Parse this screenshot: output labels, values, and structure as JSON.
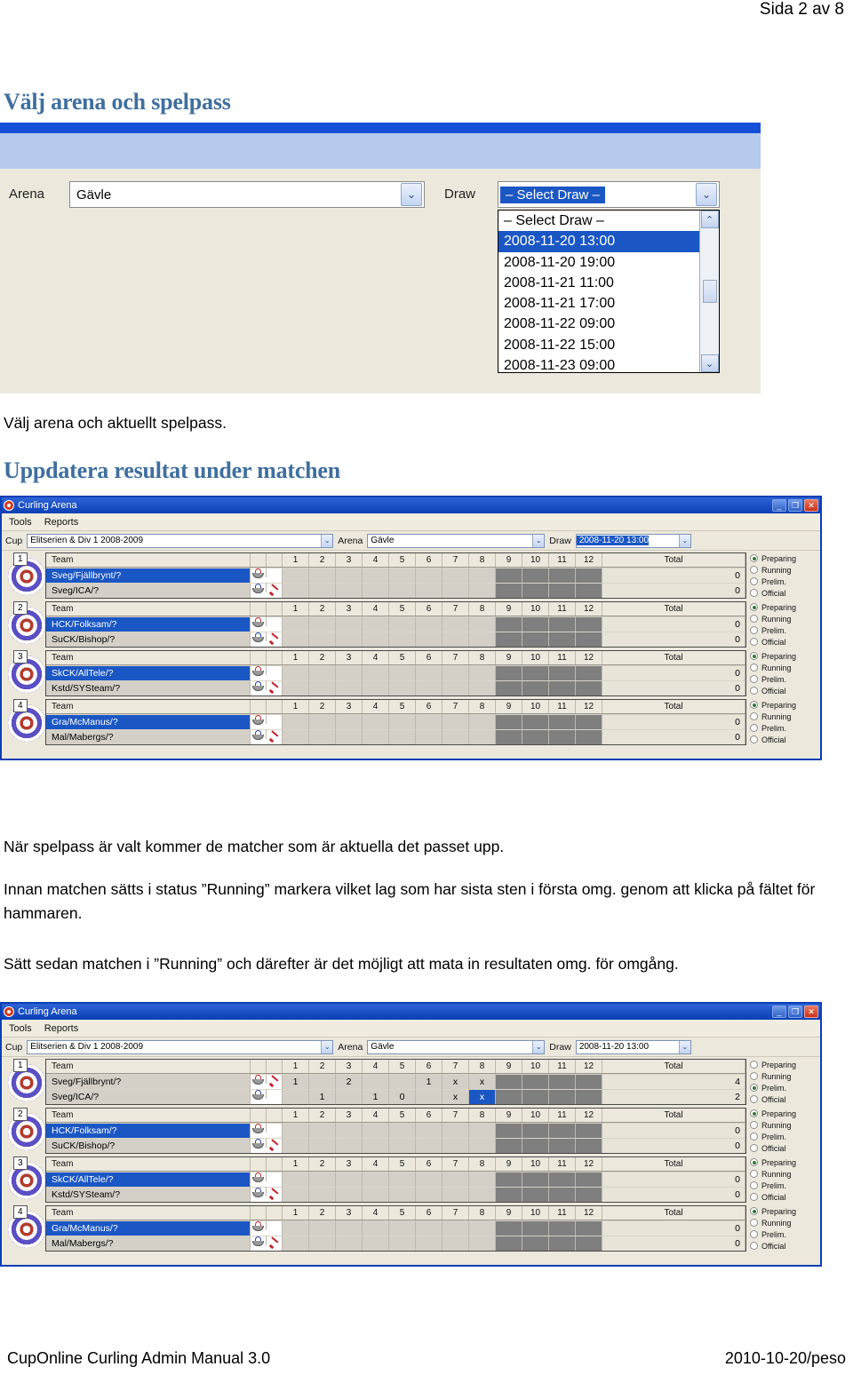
{
  "page": {
    "header_right": "Sida 2 av 8",
    "footer_left": "CupOnline Curling Admin Manual 3.0",
    "footer_right": "2010-10-20/peso"
  },
  "headings": {
    "h1": "Välj arena och spelpass",
    "h2": "Uppdatera resultat under matchen"
  },
  "paragraphs": {
    "p1": "Välj arena och aktuellt spelpass.",
    "p2": "När spelpass är valt kommer de matcher som är aktuella det passet upp.",
    "p3": "Innan matchen sätts i status ”Running” markera vilket lag som har sista sten i första omg. genom att klicka på fältet för hammaren.",
    "p4": "Sätt sedan matchen i ”Running” och därefter är det möjligt att mata in resultaten omg. för omgång."
  },
  "screenshot1": {
    "arena_label": "Arena",
    "arena_value": "Gävle",
    "draw_label": "Draw",
    "draw_value": "– Select Draw –",
    "draw_options": [
      "– Select Draw –",
      "2008-11-20 13:00",
      "2008-11-20 19:00",
      "2008-11-21 11:00",
      "2008-11-21 17:00",
      "2008-11-22 09:00",
      "2008-11-22 15:00",
      "2008-11-23 09:00"
    ],
    "draw_selected_index": 1,
    "dropdown_arrow": "⌄",
    "scroll_up": "⌃",
    "scroll_down": "⌄"
  },
  "window": {
    "title": "Curling Arena",
    "menu": [
      "Tools",
      "Reports"
    ],
    "btn_min": "_",
    "btn_max": "❐",
    "btn_close": "✕",
    "toolbar": {
      "cup_label": "Cup",
      "cup_value": "Elitserien & Div 1 2008-2009",
      "arena_label": "Arena",
      "arena_value": "Gävle",
      "draw_label": "Draw",
      "draw_value": "2008-11-20 13:00"
    },
    "columns": [
      "1",
      "2",
      "3",
      "4",
      "5",
      "6",
      "7",
      "8",
      "9",
      "10",
      "11",
      "12"
    ],
    "team_header": "Team",
    "total_header": "Total",
    "status_options": [
      "Preparing",
      "Running",
      "Prelim.",
      "Official"
    ]
  },
  "shot2": {
    "sheets": [
      {
        "number": "1",
        "status": "Preparing",
        "teams": [
          {
            "name": "Sveg/Fjällbrynt/?",
            "selected": true,
            "stone": "red",
            "hammer": false,
            "scores": [
              "",
              "",
              "",
              "",
              "",
              "",
              "",
              "",
              "",
              "",
              "",
              ""
            ],
            "total": "0"
          },
          {
            "name": "Sveg/ICA/?",
            "selected": false,
            "stone": "blue",
            "hammer": true,
            "scores": [
              "",
              "",
              "",
              "",
              "",
              "",
              "",
              "",
              "",
              "",
              "",
              ""
            ],
            "total": "0"
          }
        ]
      },
      {
        "number": "2",
        "status": "Preparing",
        "teams": [
          {
            "name": "HCK/Folksam/?",
            "selected": true,
            "stone": "red",
            "hammer": false,
            "scores": [
              "",
              "",
              "",
              "",
              "",
              "",
              "",
              "",
              "",
              "",
              "",
              ""
            ],
            "total": "0"
          },
          {
            "name": "SuCK/Bishop/?",
            "selected": false,
            "stone": "blue",
            "hammer": true,
            "scores": [
              "",
              "",
              "",
              "",
              "",
              "",
              "",
              "",
              "",
              "",
              "",
              ""
            ],
            "total": "0"
          }
        ]
      },
      {
        "number": "3",
        "status": "Preparing",
        "teams": [
          {
            "name": "SkCK/AllTele/?",
            "selected": true,
            "stone": "red",
            "hammer": false,
            "scores": [
              "",
              "",
              "",
              "",
              "",
              "",
              "",
              "",
              "",
              "",
              "",
              ""
            ],
            "total": "0"
          },
          {
            "name": "Kstd/SYSteam/?",
            "selected": false,
            "stone": "blue",
            "hammer": true,
            "scores": [
              "",
              "",
              "",
              "",
              "",
              "",
              "",
              "",
              "",
              "",
              "",
              ""
            ],
            "total": "0"
          }
        ]
      },
      {
        "number": "4",
        "status": "Preparing",
        "teams": [
          {
            "name": "Gra/McManus/?",
            "selected": true,
            "stone": "red",
            "hammer": false,
            "scores": [
              "",
              "",
              "",
              "",
              "",
              "",
              "",
              "",
              "",
              "",
              "",
              ""
            ],
            "total": "0"
          },
          {
            "name": "Mal/Mabergs/?",
            "selected": false,
            "stone": "blue",
            "hammer": true,
            "scores": [
              "",
              "",
              "",
              "",
              "",
              "",
              "",
              "",
              "",
              "",
              "",
              ""
            ],
            "total": "0"
          }
        ]
      }
    ]
  },
  "shot3": {
    "sheets": [
      {
        "number": "1",
        "status": "Prelim.",
        "teams": [
          {
            "name": "Sveg/Fjällbrynt/?",
            "selected": false,
            "stone": "red",
            "hammer": true,
            "scores": [
              "1",
              "",
              "2",
              "",
              "",
              "1",
              "x",
              "x",
              "",
              "",
              "",
              ""
            ],
            "total": "4",
            "selected_cell": -1
          },
          {
            "name": "Sveg/ICA/?",
            "selected": false,
            "stone": "blue",
            "hammer": false,
            "scores": [
              "",
              "1",
              "",
              "1",
              "0",
              "",
              "x",
              "x",
              "",
              "",
              "",
              ""
            ],
            "total": "2",
            "selected_cell": 7
          }
        ]
      },
      {
        "number": "2",
        "status": "Preparing",
        "teams": [
          {
            "name": "HCK/Folksam/?",
            "selected": true,
            "stone": "red",
            "hammer": false,
            "scores": [
              "",
              "",
              "",
              "",
              "",
              "",
              "",
              "",
              "",
              "",
              "",
              ""
            ],
            "total": "0",
            "selected_cell": -1
          },
          {
            "name": "SuCK/Bishop/?",
            "selected": false,
            "stone": "blue",
            "hammer": true,
            "scores": [
              "",
              "",
              "",
              "",
              "",
              "",
              "",
              "",
              "",
              "",
              "",
              ""
            ],
            "total": "0",
            "selected_cell": -1
          }
        ]
      },
      {
        "number": "3",
        "status": "Preparing",
        "teams": [
          {
            "name": "SkCK/AllTele/?",
            "selected": true,
            "stone": "red",
            "hammer": false,
            "scores": [
              "",
              "",
              "",
              "",
              "",
              "",
              "",
              "",
              "",
              "",
              "",
              ""
            ],
            "total": "0",
            "selected_cell": -1
          },
          {
            "name": "Kstd/SYSteam/?",
            "selected": false,
            "stone": "blue",
            "hammer": true,
            "scores": [
              "",
              "",
              "",
              "",
              "",
              "",
              "",
              "",
              "",
              "",
              "",
              ""
            ],
            "total": "0",
            "selected_cell": -1
          }
        ]
      },
      {
        "number": "4",
        "status": "Preparing",
        "teams": [
          {
            "name": "Gra/McManus/?",
            "selected": true,
            "stone": "red",
            "hammer": false,
            "scores": [
              "",
              "",
              "",
              "",
              "",
              "",
              "",
              "",
              "",
              "",
              "",
              ""
            ],
            "total": "0",
            "selected_cell": -1
          },
          {
            "name": "Mal/Mabergs/?",
            "selected": false,
            "stone": "blue",
            "hammer": true,
            "scores": [
              "",
              "",
              "",
              "",
              "",
              "",
              "",
              "",
              "",
              "",
              "",
              ""
            ],
            "total": "0",
            "selected_cell": -1
          }
        ]
      }
    ]
  },
  "colors": {
    "heading_blue": "#3f6f9f",
    "title_blue": "#0a3fb5",
    "selection_blue": "#1b57c4",
    "disabled_grey": "#7f7f7f",
    "panel_beige": "#ece8dc"
  }
}
